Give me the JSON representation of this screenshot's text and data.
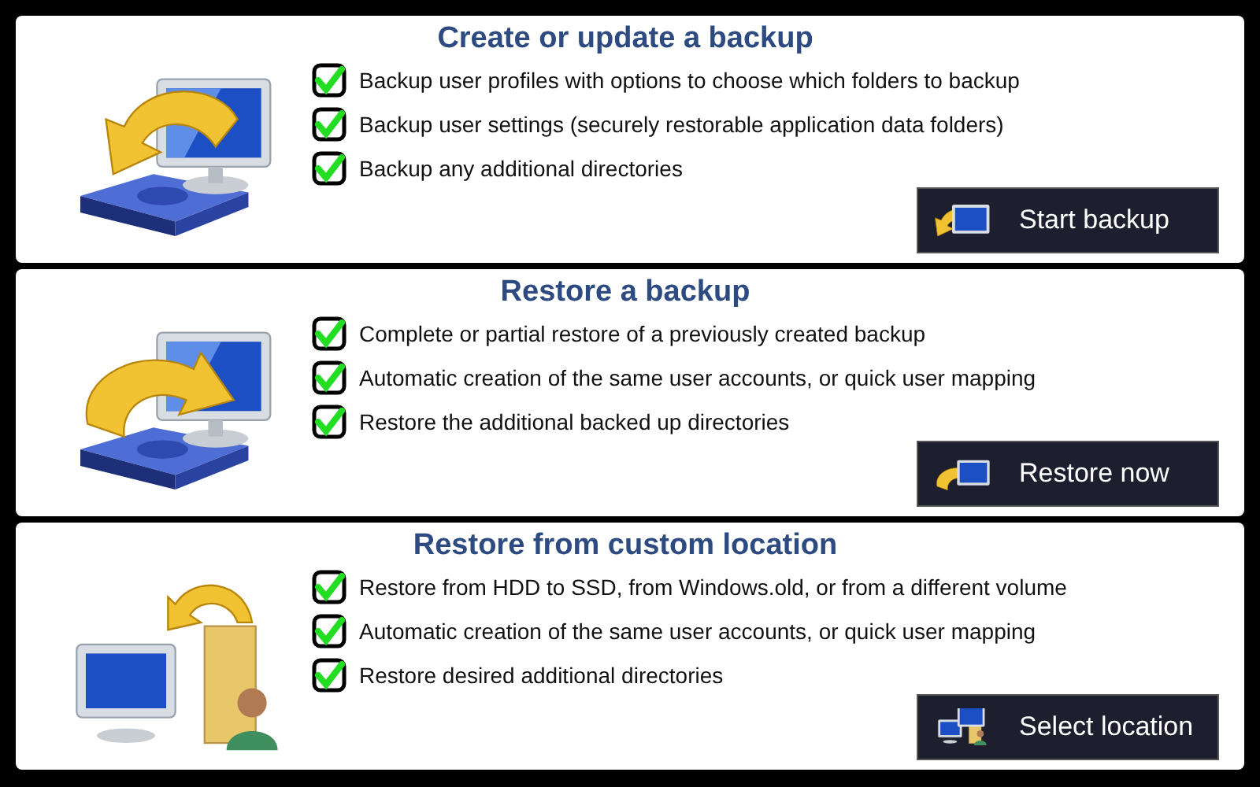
{
  "sections": [
    {
      "title": "Create or update a backup",
      "kind": "backup",
      "features": [
        {
          "text": "Backup user profiles with options to choose which folders to backup",
          "checked": true
        },
        {
          "text": "Backup user settings (securely restorable application data folders)",
          "checked": true
        },
        {
          "text": "Backup any additional directories",
          "checked": true
        }
      ],
      "button": {
        "label": "Start backup"
      }
    },
    {
      "title": "Restore a backup",
      "kind": "restore",
      "features": [
        {
          "text": "Complete or partial restore of a previously created backup",
          "checked": true
        },
        {
          "text": "Automatic creation of the same user accounts, or quick user mapping",
          "checked": true
        },
        {
          "text": "Restore the additional backed up directories",
          "checked": true
        }
      ],
      "button": {
        "label": "Restore now"
      }
    },
    {
      "title": "Restore from custom location",
      "kind": "custom",
      "features": [
        {
          "text": "Restore from HDD to SSD, from Windows.old, or from a different volume",
          "checked": true
        },
        {
          "text": "Automatic creation of the same user accounts, or quick user mapping",
          "checked": true
        },
        {
          "text": "Restore desired additional directories",
          "checked": true
        }
      ],
      "button": {
        "label": "Select location"
      }
    }
  ]
}
